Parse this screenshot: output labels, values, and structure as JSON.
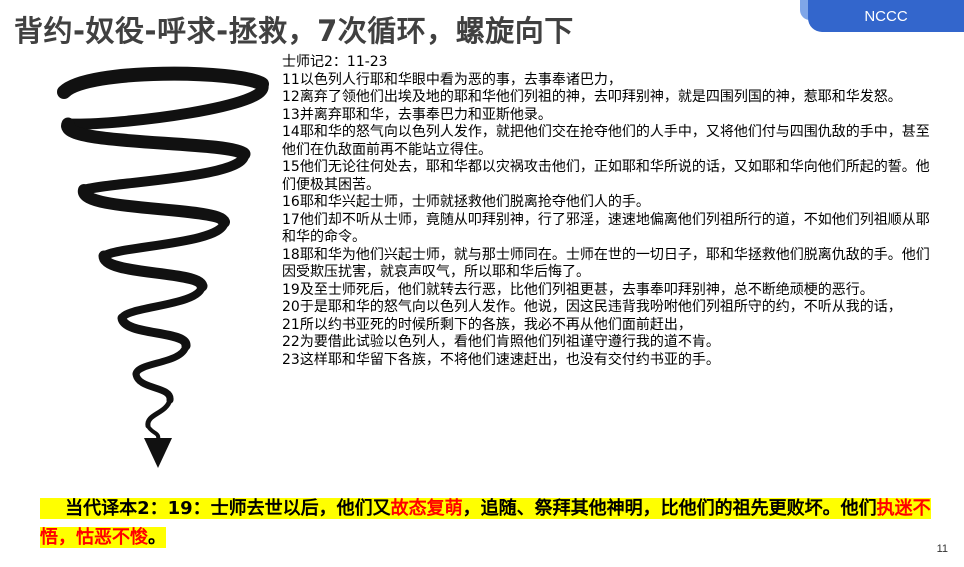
{
  "header": {
    "title": "背约-奴役-呼求-拯救，7次循环，螺旋向下",
    "badge": "NCCC"
  },
  "illustration": {
    "icon": "downward-spiral-arrow-icon",
    "color": "#111111"
  },
  "scripture": {
    "reference": "士师记2：11-23",
    "verses": [
      "11以色列人行耶和华眼中看为恶的事，去事奉诸巴力，",
      "12离弃了领他们出埃及地的耶和华他们列祖的神，去叩拜别神，就是四围列国的神，惹耶和华发怒。",
      "13并离弃耶和华，去事奉巴力和亚斯他录。",
      "14耶和华的怒气向以色列人发作，就把他们交在抢夺他们的人手中，又将他们付与四围仇敌的手中，甚至他们在仇敌面前再不能站立得住。",
      "15他们无论往何处去，耶和华都以灾祸攻击他们，正如耶和华所说的话，又如耶和华向他们所起的誓。他们便极其困苦。",
      "16耶和华兴起士师，士师就拯救他们脱离抢夺他们人的手。",
      "17他们却不听从士师，竟随从叩拜别神，行了邪淫，速速地偏离他们列祖所行的道，不如他们列祖顺从耶和华的命令。",
      "18耶和华为他们兴起士师，就与那士师同在。士师在世的一切日子，耶和华拯救他们脱离仇敌的手。他们因受欺压扰害，就哀声叹气，所以耶和华后悔了。",
      "19及至士师死后，他们就转去行恶，比他们列祖更甚，去事奉叩拜别神，总不断绝顽梗的恶行。",
      "20于是耶和华的怒气向以色列人发作。他说，因这民违背我吩咐他们列祖所守的约，不听从我的话，",
      "21所以约书亚死的时候所剩下的各族，我必不再从他们面前赶出，",
      "22为要借此试验以色列人，看他们肯照他们列祖谨守遵行我的道不肯。",
      "23这样耶和华留下各族，不将他们速速赶出，也没有交付约书亚的手。"
    ]
  },
  "highlight": {
    "part1": "当代译本2：19：士师去世以后，他们又",
    "red1": "故态复萌",
    "part2": "，追随、祭拜其他神明，比他们的祖先",
    "part3": "更败坏。他们",
    "red2": "执迷不悟，怙恶不悛",
    "part4": "。",
    "colors": {
      "background": "#ffff00",
      "emphasis": "#ff0000"
    }
  },
  "footer": {
    "page_number": "11"
  },
  "colors": {
    "badge": "#3366cc",
    "title": "#404040"
  }
}
